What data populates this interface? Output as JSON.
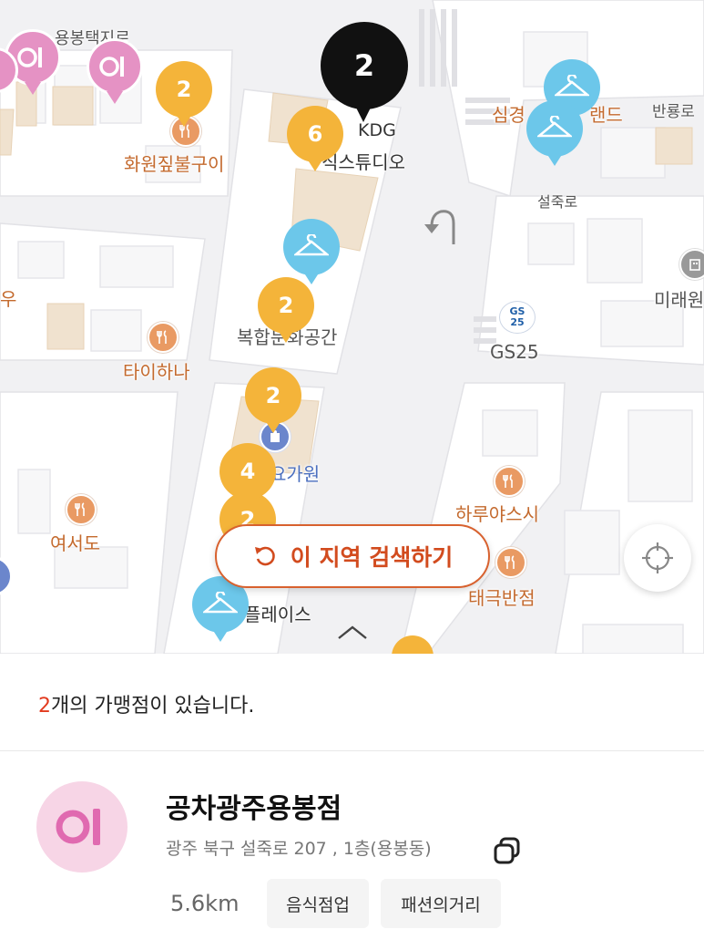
{
  "map": {
    "streets": [
      "용봉택지로",
      "설죽로"
    ],
    "places": [
      {
        "name": "화원짚불구이",
        "kind": "restaurant"
      },
      {
        "name": "KDG",
        "kind": "label"
      },
      {
        "name": "직스튜디오",
        "kind": "label"
      },
      {
        "name": "심경",
        "kind": "label"
      },
      {
        "name": "랜드",
        "kind": "label"
      },
      {
        "name": "반룡로",
        "kind": "label"
      },
      {
        "name": "우",
        "kind": "label"
      },
      {
        "name": "미래원",
        "kind": "label"
      },
      {
        "name": "복합문화공간",
        "kind": "label"
      },
      {
        "name": "타이하나",
        "kind": "restaurant"
      },
      {
        "name": "GS25",
        "kind": "store"
      },
      {
        "name": "요가원",
        "kind": "label"
      },
      {
        "name": "하루야스시",
        "kind": "restaurant"
      },
      {
        "name": "여서도",
        "kind": "restaurant"
      },
      {
        "name": "태극반점",
        "kind": "restaurant"
      },
      {
        "name": "플레이스",
        "kind": "label"
      }
    ],
    "clusters": [
      {
        "count": "2",
        "color": "#f4b43a",
        "selected": false
      },
      {
        "count": "2",
        "color": "#111111",
        "selected": true
      },
      {
        "count": "6",
        "color": "#f4b43a",
        "selected": false
      },
      {
        "count": "2",
        "color": "#f4b43a",
        "selected": false
      },
      {
        "count": "2",
        "color": "#f4b43a",
        "selected": false
      },
      {
        "count": "4",
        "color": "#f4b43a",
        "selected": false
      },
      {
        "count": "2",
        "color": "#f4b43a",
        "selected": false
      }
    ],
    "pin_colors": {
      "cluster": "#f4b43a",
      "selected": "#111111",
      "fashion": "#6cc7ea",
      "food": "#e592c4"
    },
    "gs_badge": "GS\n25"
  },
  "controls": {
    "search_area_label": "이 지역 검색하기",
    "refresh_icon": "refresh-icon",
    "locate_icon": "crosshair-icon",
    "expand_icon": "chevron-up-icon"
  },
  "panel": {
    "count_number": "2",
    "count_text": "개의 가맹점이 있습니다.",
    "store": {
      "logo_text": "이",
      "name": "공차광주용봉점",
      "address": "광주 북구 설죽로 207 , 1층(용봉동)",
      "distance": "5.6km",
      "tags": [
        "음식점업",
        "패션의거리"
      ]
    }
  }
}
